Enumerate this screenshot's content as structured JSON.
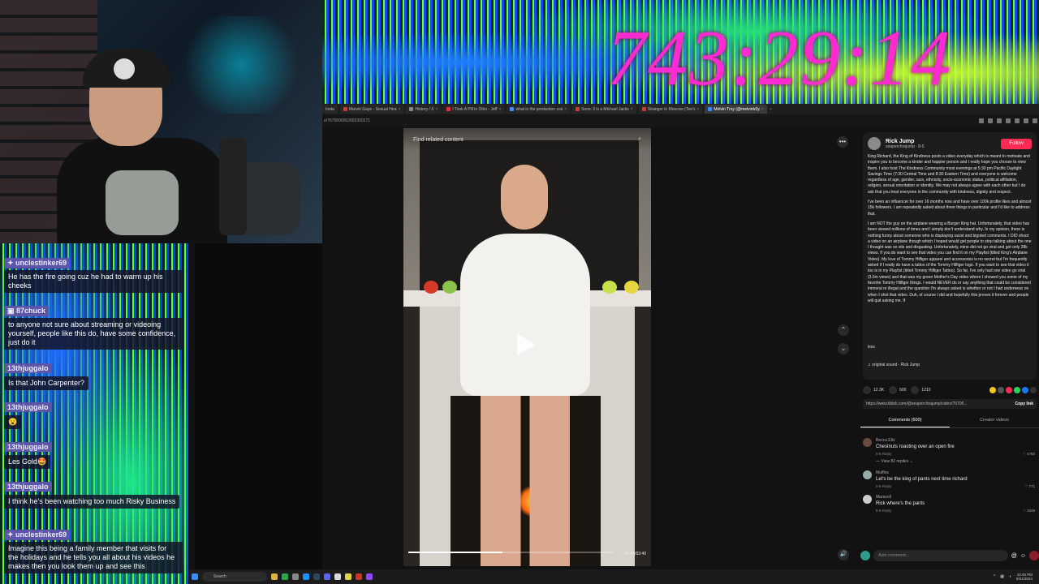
{
  "overlay": {
    "timer": "743:29:14"
  },
  "browser": {
    "tabs": [
      {
        "label": "Insta"
      },
      {
        "label": "Marvin Gaye - Sexual Hea"
      },
      {
        "label": "History / X"
      },
      {
        "label": "I Took A Pill in Ohio - Jeff"
      },
      {
        "label": "what is the production cos"
      },
      {
        "label": "Sonic 3 is a Michael Jacks"
      },
      {
        "label": "Stranger in Moscow (Tee's"
      },
      {
        "label": "Melvin Troy (@melvintr0y"
      }
    ],
    "address": "o/7670600062655300271"
  },
  "video": {
    "find_related": "Find related content",
    "time": "01:42/03:40",
    "progress": 0.46
  },
  "post": {
    "author": "Rick Jump",
    "handle": "seaperchrajump · 8-5",
    "follow": "Follow",
    "desc": [
      "King Richard, the King of Kindness posts a video everyday which is meant to motivate and inspire you to become a kinder and happier person and I really hope you choose to view them. I also host The Kindness Community most evenings at 5:30 pm Pacific Daylight Savings Time (7:30 Central Time and 8:30 Eastern Time) and everyone is welcome regardless of age, gender, race, ethnicity, socio-economic status, political affiliation, religion, sexual orientation or identity. We may not always agree with each other but I do ask that you treat everyone in the community with kindness, dignity and respect.",
      "I've been an influencer for over 16 months now and have over 100k profile likes and almost 15k followers. I am repeatedly asked about three things in particular and I'd like to address that.",
      "I am NOT the guy on the airplane wearing a Burger King hat. Unfortunately, that video has been viewed millions of times and I simply don't understand why. In my opinion, there is nothing funny about someone who is displaying racist and bigoted comments. I DID shoot a video on an airplane though which I hoped would get people to stop talking about the one I thought was so vile and disgusting. Unfortunately, mine did not go viral and got only 28k views. If you do want to see that video you can find it on my Playlist (titled King's Airplane Video). My love of Tommy Hilfiger apparel and accessories is no secret but I'm frequently asked if I really do have a tattoo of the Tommy Hilfiger logo. If you want to see that video it too is in my Playlist (titled Tommy Hilfiger Tattoo). So far, I've only had one video go viral (3.5m views) and that was my green Mother's Day video where I showed you some of my favorite Tommy Hilfiger things. I would NEVER do or say anything that could be considered immoral or illegal and the question I'm always asked is whether or not I had underwear on when I shot that video. Duh, of course I did and hopefully this proves it forever and people will quit asking me. If"
    ],
    "less": "less",
    "sound": "original sound - Rick Jump",
    "likes": "12.3K",
    "comments_count": "600",
    "saves": "1210",
    "link": "https://www.tiktok.com/@seaperchrajump/video/76706...",
    "copy_link": "Copy link",
    "tab_comments": "Comments (600)",
    "tab_creator": "Creator videos"
  },
  "comments": [
    {
      "user": "Becca Eltz",
      "text": "Chestnuts roasting over an open fire",
      "meta": "8-6     Reply",
      "likes": "4760"
    },
    {
      "user": "Muffins",
      "text": "Let's be the king of pants next time richard",
      "meta": "8-6     Reply",
      "likes": "771"
    },
    {
      "user": "Marasoll",
      "text": "Rick where's the pants",
      "meta": "8-5     Reply",
      "likes": "1549"
    }
  ],
  "view_replies": "View 82 replies",
  "comment_placeholder": "Add comment...",
  "chat": [
    {
      "user": "unclestinker69",
      "text": "He has the fire going cuz he had to warm up his cheeks"
    },
    {
      "user": "87chuck",
      "text": "to anyone not sure about streaming or videoing yourself, people like this do, have some confidence, just do it"
    },
    {
      "user": "13thjuggalo",
      "text": "Is that John Carpenter?"
    },
    {
      "user": "13thjuggalo",
      "text": "😮"
    },
    {
      "user": "13thjuggalo",
      "text": "Les Gold🤩"
    },
    {
      "user": "13thjuggalo",
      "text": "I think he's been watching too much Risky Business"
    },
    {
      "user": "unclestinker69",
      "text": "Imagine this being a family member that visits for the holidays and he tells you all about his videos he makes then you look them up and see this"
    }
  ],
  "taskbar": {
    "search": "Search",
    "time": "10:45 PM",
    "date": "8/21/2024"
  },
  "colors": {
    "follow": "#fe2c55",
    "chat_user_bg": "#5d56a8",
    "timer": "#ff2bd0"
  }
}
